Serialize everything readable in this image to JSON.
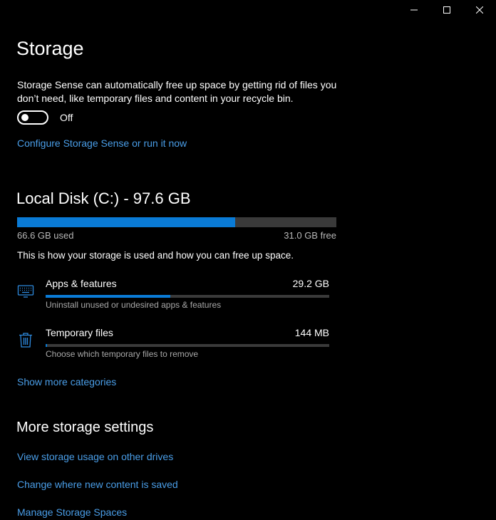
{
  "window": {
    "controls": [
      "minimize-icon",
      "maximize-icon",
      "close-icon"
    ]
  },
  "page": {
    "title": "Storage",
    "description": "Storage Sense can automatically free up space by getting rid of files you don’t need, like temporary files and content in your recycle bin.",
    "toggle_state": "Off",
    "configure_link": "Configure Storage Sense or run it now"
  },
  "disk": {
    "title": "Local Disk (C:) - 97.6 GB",
    "used_label": "66.6 GB used",
    "free_label": "31.0 GB free",
    "used_fraction": 0.682,
    "usage_text": "This is how your storage is used and how you can free up space."
  },
  "categories": [
    {
      "name": "Apps & features",
      "size": "29.2 GB",
      "description": "Uninstall unused or undesired apps & features",
      "fraction": 0.44,
      "icon": "keyboard-icon"
    },
    {
      "name": "Temporary files",
      "size": "144 MB",
      "description": "Choose which temporary files to remove",
      "fraction": 0.004,
      "icon": "trash-icon"
    }
  ],
  "show_more": "Show more categories",
  "more_settings": {
    "title": "More storage settings",
    "links": [
      "View storage usage on other drives",
      "Change where new content is saved",
      "Manage Storage Spaces"
    ]
  },
  "colors": {
    "accent": "#0a7bd6",
    "link": "#4a9ee8",
    "track": "#3a3a3a",
    "background": "#000000"
  }
}
